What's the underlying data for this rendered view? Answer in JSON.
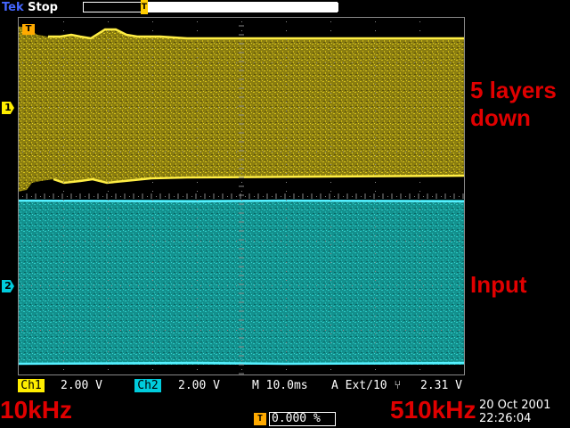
{
  "header": {
    "brand": "Tek",
    "acq_mode": "Stop",
    "trigger_pos_icon": "trigger-position-icon"
  },
  "channels": [
    {
      "id": "1",
      "label": "Ch1",
      "scale": "2.00 V",
      "color": "#ffee00"
    },
    {
      "id": "2",
      "label": "Ch2",
      "scale": "2.00 V",
      "color": "#00ccdd"
    }
  ],
  "timebase": {
    "scale": "M 10.0ms"
  },
  "trigger": {
    "marker": "T",
    "source": "A Ext/10 ⑂",
    "level": "2.31 V",
    "position_pct": "0.000 %"
  },
  "datetime": {
    "date": "20 Oct  2001",
    "time": "22:26:04"
  },
  "annotations": {
    "top": "5 layers down",
    "input": "Input",
    "left": "10kHz",
    "right": "510kHz"
  },
  "colors": {
    "ch1": "#ffee00",
    "ch2": "#00ccdd",
    "annotation": "#e00000",
    "graticule": "#888888"
  }
}
